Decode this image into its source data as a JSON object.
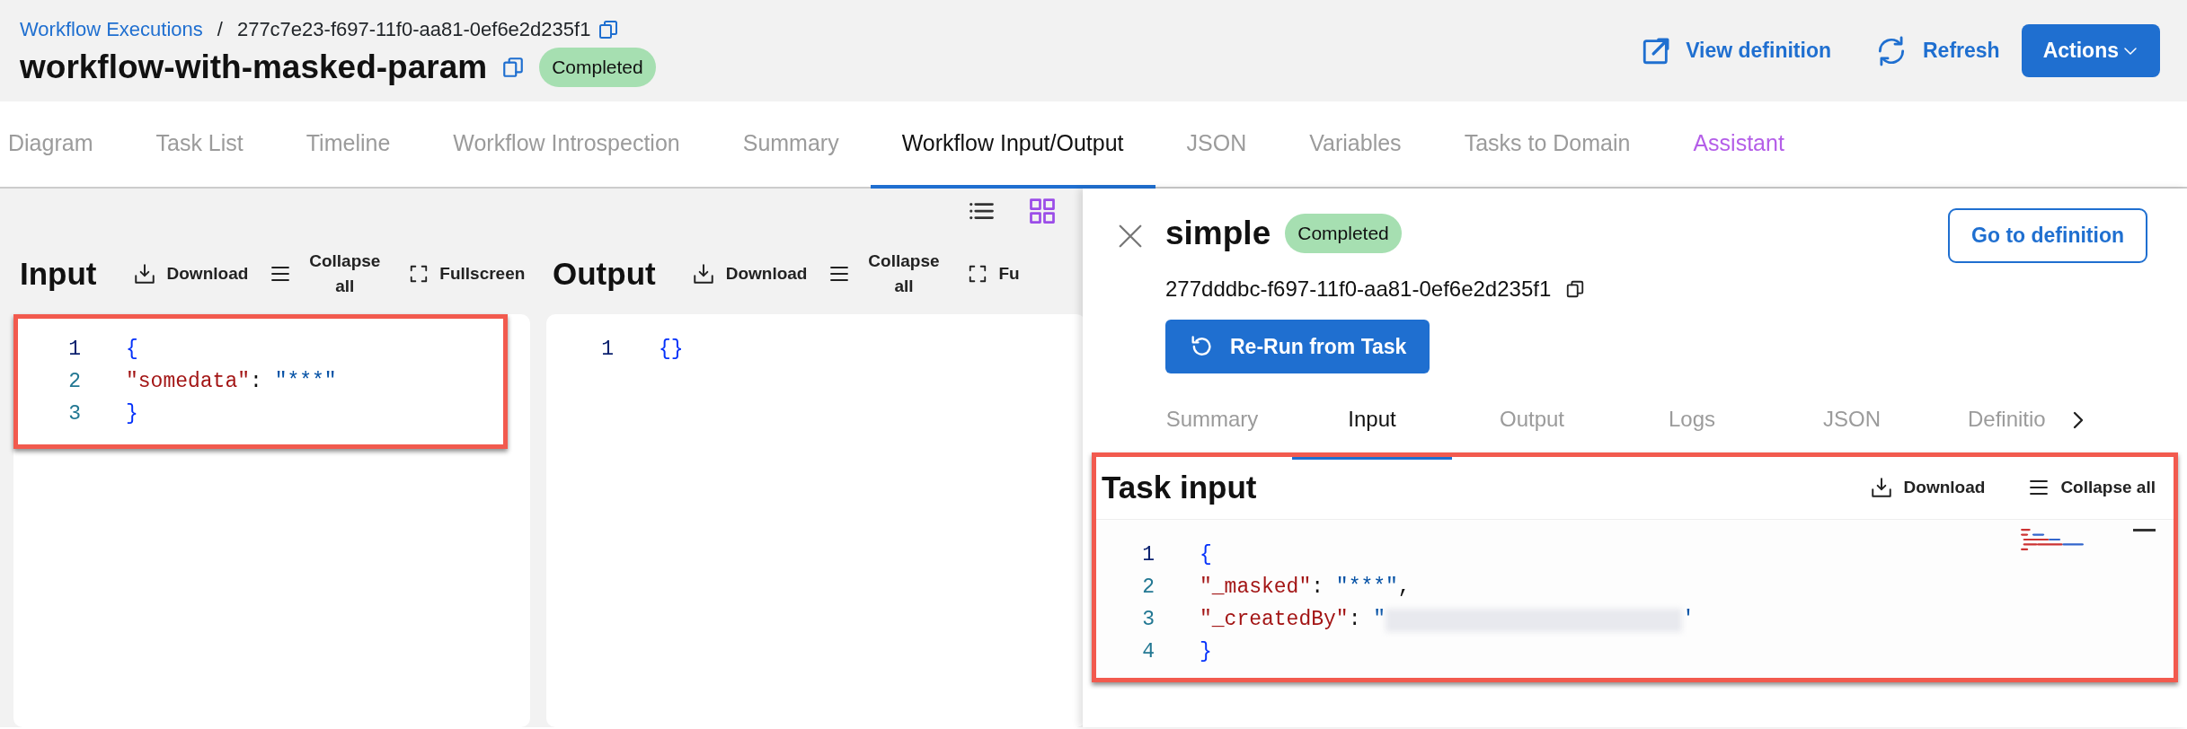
{
  "header": {
    "breadcrumb": {
      "link": "Workflow Executions",
      "separator": "/",
      "id": "277c7e23-f697-11f0-aa81-0ef6e2d235f1"
    },
    "title": "workflow-with-masked-param",
    "status": "Completed",
    "actions": [
      {
        "kind": "view",
        "label": "View definition"
      },
      {
        "kind": "refresh",
        "label": "Refresh"
      },
      {
        "kind": "menu",
        "label": "Actions"
      }
    ]
  },
  "tabs": [
    {
      "label": "Diagram",
      "selected": false,
      "kind": "normal"
    },
    {
      "label": "Task List",
      "selected": false,
      "kind": "normal"
    },
    {
      "label": "Timeline",
      "selected": false,
      "kind": "normal"
    },
    {
      "label": "Workflow Introspection",
      "selected": false,
      "kind": "normal"
    },
    {
      "label": "Summary",
      "selected": false,
      "kind": "normal"
    },
    {
      "label": "Workflow Input/Output",
      "selected": true,
      "kind": "normal"
    },
    {
      "label": "JSON",
      "selected": false,
      "kind": "normal"
    },
    {
      "label": "Variables",
      "selected": false,
      "kind": "normal"
    },
    {
      "label": "Tasks to Domain",
      "selected": false,
      "kind": "normal"
    },
    {
      "label": "Assistant",
      "selected": false,
      "kind": "assistant"
    }
  ],
  "view_toggle": [
    {
      "kind": "list",
      "selected": false
    },
    {
      "kind": "grid",
      "selected": true
    }
  ],
  "panels": [
    {
      "title": "Input",
      "highlighted": true,
      "tools": [
        {
          "kind": "download",
          "label": "Download"
        },
        {
          "kind": "collapse",
          "label": "Collapse all"
        },
        {
          "kind": "fullscreen",
          "label": "Fullscreen"
        }
      ],
      "code": [
        {
          "number": "1",
          "current": true,
          "tokens": [
            {
              "kind": "brace",
              "text": "{"
            }
          ]
        },
        {
          "number": "2",
          "current": false,
          "tokens": [
            {
              "kind": "key",
              "text": "\"somedata\""
            },
            {
              "kind": "punct",
              "text": ": "
            },
            {
              "kind": "string",
              "text": "\"***\""
            }
          ]
        },
        {
          "number": "3",
          "current": false,
          "tokens": [
            {
              "kind": "brace",
              "text": "}"
            }
          ]
        }
      ]
    },
    {
      "title": "Output",
      "highlighted": false,
      "tools": [
        {
          "kind": "download",
          "label": "Download"
        },
        {
          "kind": "collapse",
          "label": "Collapse all"
        },
        {
          "kind": "fullscreen",
          "label": "Fu"
        }
      ],
      "code": [
        {
          "number": "1",
          "current": true,
          "tokens": [
            {
              "kind": "brace",
              "text": "{}"
            }
          ]
        }
      ]
    }
  ],
  "drawer": {
    "title": "simple",
    "status": "Completed",
    "id": "277dddbc-f697-11f0-aa81-0ef6e2d235f1",
    "go_button": "Go to definition",
    "rerun_button": "Re-Run from Task",
    "tabs": [
      {
        "label": "Summary",
        "selected": false
      },
      {
        "label": "Input",
        "selected": true
      },
      {
        "label": "Output",
        "selected": false
      },
      {
        "label": "Logs",
        "selected": false
      },
      {
        "label": "JSON",
        "selected": false
      },
      {
        "label": "Definitio",
        "selected": false
      }
    ],
    "section": {
      "title": "Task input",
      "highlighted": true,
      "tools": [
        {
          "kind": "download",
          "label": "Download"
        },
        {
          "kind": "collapse",
          "label": "Collapse all"
        }
      ],
      "code": [
        {
          "number": "1",
          "current": true,
          "tokens": [
            {
              "kind": "brace",
              "text": "{"
            }
          ]
        },
        {
          "number": "2",
          "current": false,
          "tokens": [
            {
              "kind": "key",
              "text": "\"_masked\""
            },
            {
              "kind": "punct",
              "text": ": "
            },
            {
              "kind": "string",
              "text": "\"***\""
            },
            {
              "kind": "punct",
              "text": ","
            }
          ]
        },
        {
          "number": "3",
          "current": false,
          "tokens": [
            {
              "kind": "key",
              "text": "\"_createdBy\""
            },
            {
              "kind": "punct",
              "text": ": "
            },
            {
              "kind": "string",
              "text": "\""
            },
            {
              "kind": "redacted"
            },
            {
              "kind": "string",
              "text": "'"
            }
          ]
        },
        {
          "number": "4",
          "current": false,
          "tokens": [
            {
              "kind": "brace",
              "text": "}"
            }
          ]
        }
      ]
    }
  }
}
